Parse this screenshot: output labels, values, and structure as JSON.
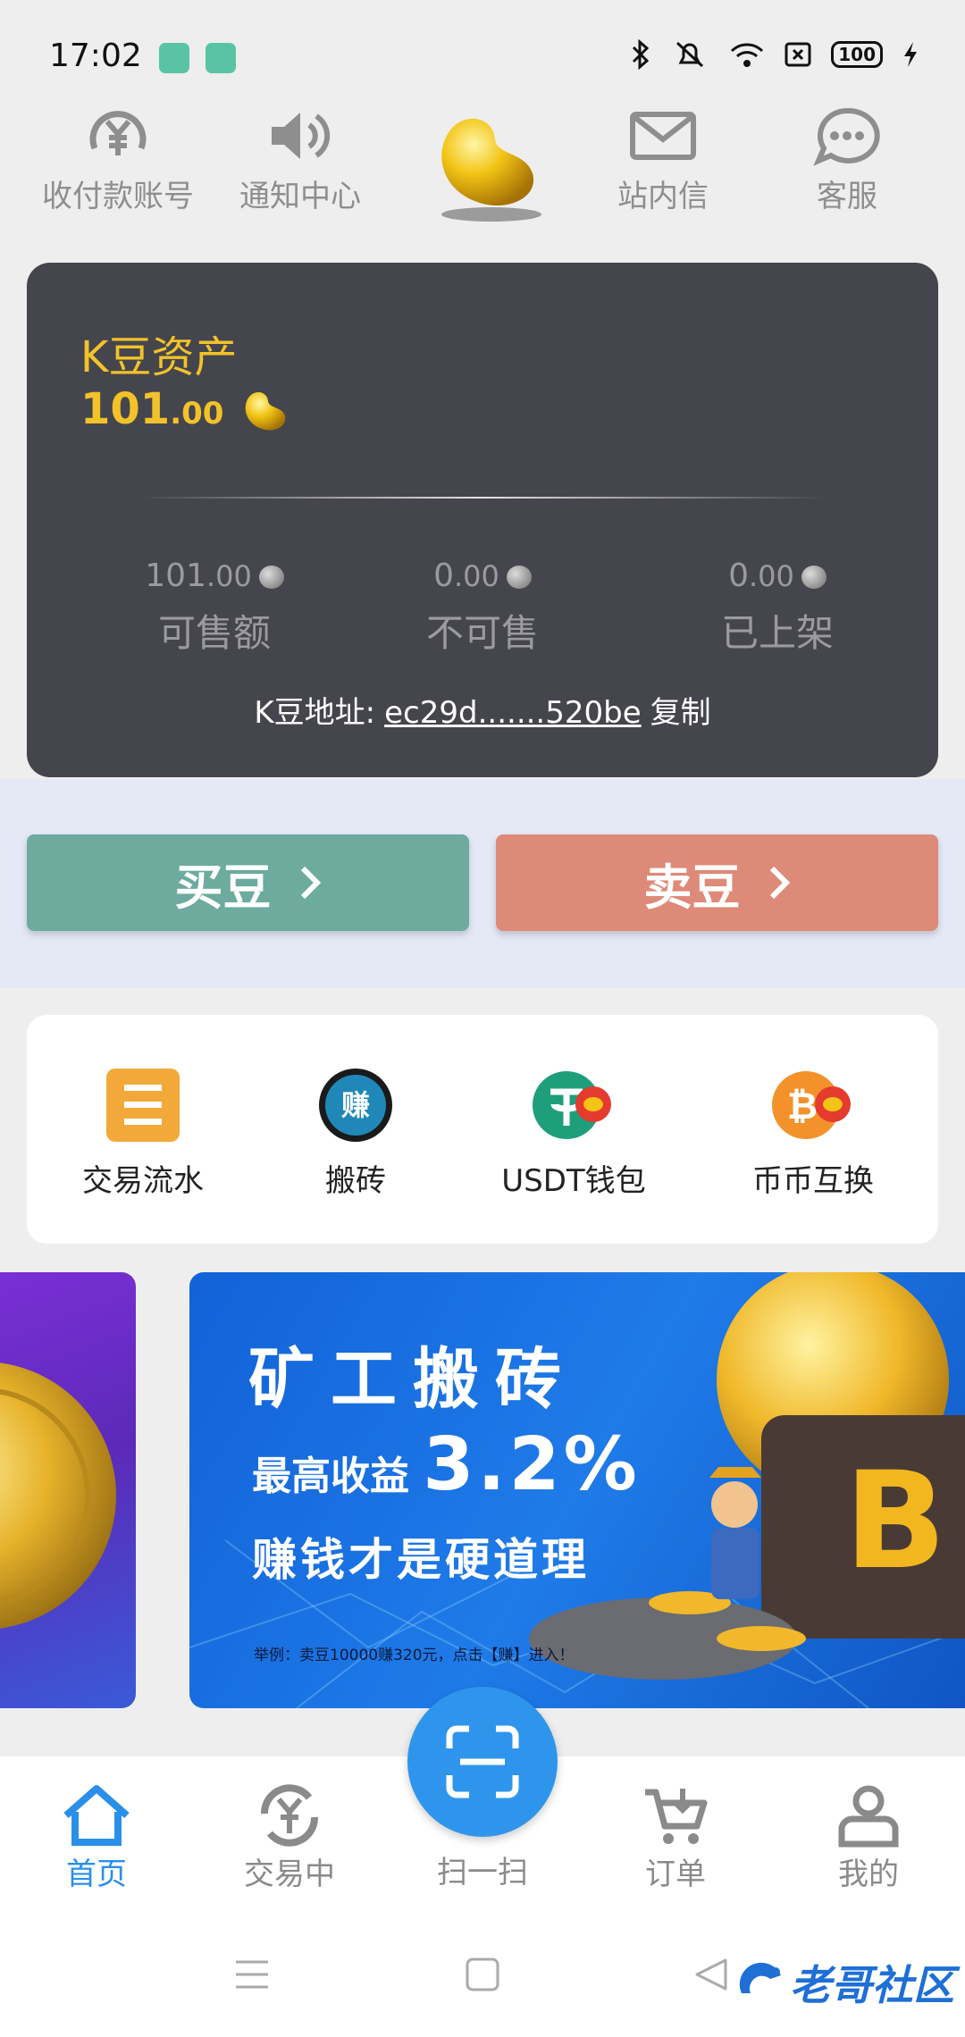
{
  "status_bar": {
    "time": "17:02",
    "battery": "100"
  },
  "top_nav": {
    "items": [
      {
        "label": "收付款账号",
        "icon": "yen-circle-icon"
      },
      {
        "label": "通知中心",
        "icon": "speaker-icon"
      },
      {
        "label": "站内信",
        "icon": "envelope-icon"
      },
      {
        "label": "客服",
        "icon": "chat-bubble-icon"
      }
    ],
    "logo": "gold-bean-logo"
  },
  "asset_card": {
    "title": "K豆资产",
    "amount_int": "101",
    "amount_dec": ".00",
    "stats": [
      {
        "int": "101",
        "dec": ".00",
        "label": "可售额"
      },
      {
        "int": "0",
        "dec": ".00",
        "label": "不可售"
      },
      {
        "int": "0",
        "dec": ".00",
        "label": "已上架"
      }
    ],
    "address_label": "K豆地址:",
    "address_value": "ec29d.......520be",
    "copy_label": "复制"
  },
  "actions": {
    "buy_label": "买豆",
    "sell_label": "卖豆"
  },
  "quick_entries": [
    {
      "label": "交易流水",
      "icon": "ledger-icon"
    },
    {
      "label": "搬砖",
      "icon": "earn-badge-icon"
    },
    {
      "label": "USDT钱包",
      "icon": "usdt-wallet-icon"
    },
    {
      "label": "币币互换",
      "icon": "bitcoin-swap-icon"
    }
  ],
  "banner": {
    "title": "矿工搬砖",
    "sub_prefix": "最高收益",
    "sub_value": "3.2%",
    "line": "赚钱才是硬道理",
    "note": "举例：卖豆10000赚320元，点击【赚】进入！"
  },
  "bottom_tabs": [
    {
      "label": "首页",
      "icon": "home-icon",
      "active": true
    },
    {
      "label": "交易中",
      "icon": "yen-exchange-icon",
      "active": false
    },
    {
      "label": "扫一扫",
      "icon": "scan-icon",
      "active": false
    },
    {
      "label": "订单",
      "icon": "cart-icon",
      "active": false
    },
    {
      "label": "我的",
      "icon": "user-icon",
      "active": false
    }
  ],
  "watermark": {
    "text": "老哥社区"
  },
  "colors": {
    "accent_blue": "#2f95ec",
    "asset_gold": "#f2c22a",
    "buy_green": "#6cab9d",
    "sell_red": "#de8a78",
    "card_dark": "#45454d"
  }
}
